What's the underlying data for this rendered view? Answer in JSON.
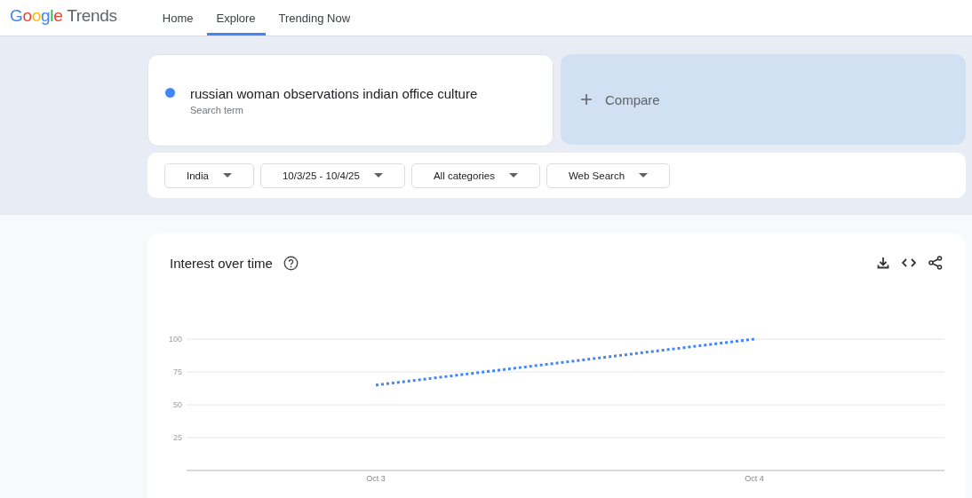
{
  "header": {
    "logo_brand": "Google",
    "logo_product": "Trends",
    "nav": [
      {
        "label": "Home",
        "selected": false
      },
      {
        "label": "Explore",
        "selected": true
      },
      {
        "label": "Trending Now",
        "selected": false
      }
    ]
  },
  "search_term": {
    "term": "russian woman observations indian office culture",
    "caption": "Search term",
    "color": "#4285f4"
  },
  "compare": {
    "label": "Compare"
  },
  "filters": [
    {
      "label": "India"
    },
    {
      "label": "10/3/25 - 10/4/25"
    },
    {
      "label": "All categories"
    },
    {
      "label": "Web Search"
    }
  ],
  "interest_over_time": {
    "title": "Interest over time",
    "chart_data": {
      "type": "line",
      "x": [
        "Oct 3",
        "Oct 4"
      ],
      "series": [
        {
          "color": "#4285f4",
          "line_style": "dotted",
          "values": [
            65,
            100
          ]
        }
      ],
      "grid": true,
      "ylim": [
        0,
        100
      ],
      "yticks": [
        25,
        50,
        75,
        100
      ]
    }
  }
}
